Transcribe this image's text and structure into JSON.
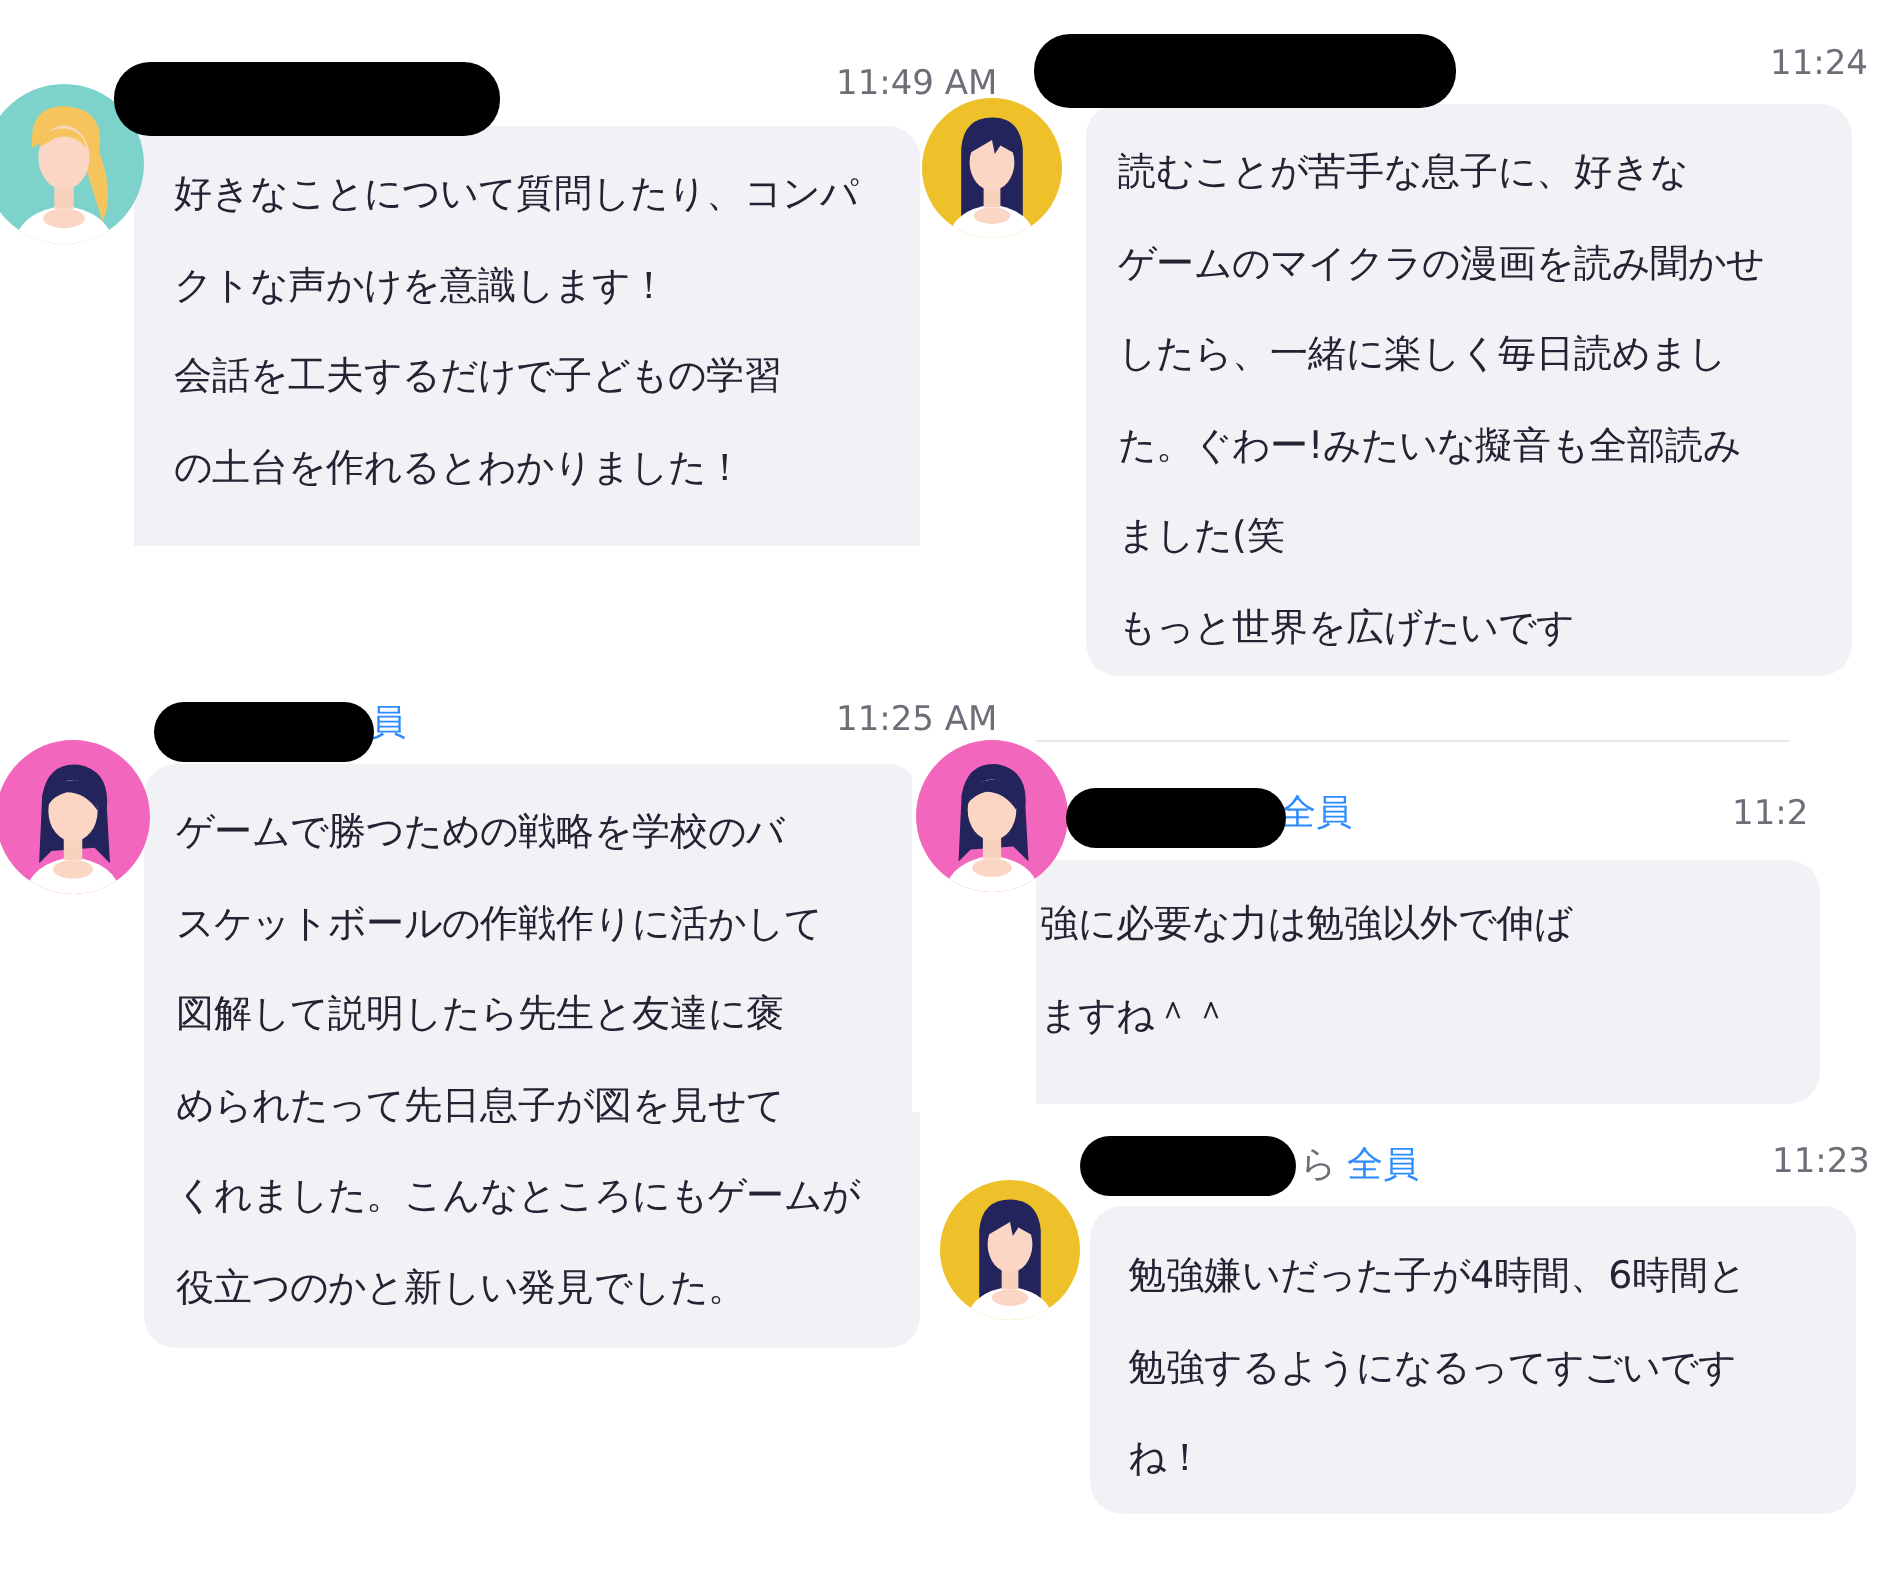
{
  "messages": [
    {
      "avatar": {
        "kind": "ponytail",
        "color": "#7dd3cc"
      },
      "redacted": true,
      "time": "11:49 AM",
      "text": "好きなことについて質問したり、コンパクトな声かけを意識します！会話を工夫するだけで子どもの学習の土台を作れるとわかりました！"
    },
    {
      "avatar": {
        "kind": "bangs",
        "color": "#eec12a"
      },
      "redacted": true,
      "time": "11:24",
      "text": "読むことが苦手な息子に、好きなゲームのマイクラの漫画を読み聞かせしたら、一緒に楽しく毎日読めました。ぐわー!みたいな擬音も全部読みました(笑もっと世界を広げたいです"
    },
    {
      "avatar": {
        "kind": "side",
        "color": "#f266bd"
      },
      "redacted": true,
      "recipient": "員",
      "time": "11:25 AM",
      "text": "ゲームで勝つための戦略を学校のバスケットボールの作戦作りに活かして図解して説明したら先生と友達に褒められたって先日息子が図を見せてくれました。こんなところにもゲームが役立つのかと新しい発見でした。"
    },
    {
      "avatar": {
        "kind": "side",
        "color": "#f266bd"
      },
      "redacted": true,
      "recipient": "全員",
      "time": "11:2",
      "text": "強に必要な力は勉強以外で伸ばますね＾＾"
    },
    {
      "avatar": {
        "kind": "bangs",
        "color": "#eec12a"
      },
      "redacted": true,
      "via": "ら",
      "recipient": "全員",
      "time": "11:23",
      "text": "勉強嫌いだった子が4時間、6時間と勉強するようになるってすごいですね！"
    }
  ]
}
